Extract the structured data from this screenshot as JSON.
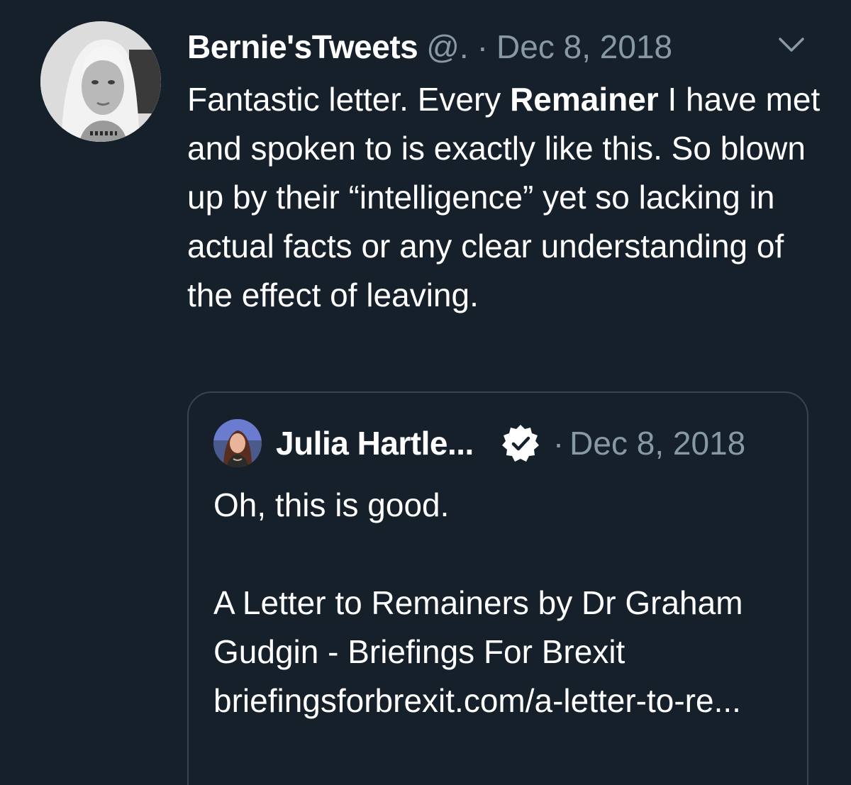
{
  "tweet": {
    "author_name": "Bernie'sTweets",
    "author_handle": "@.",
    "separator": "·",
    "date": "Dec 8, 2018",
    "text_before_bold": "Fantastic letter. Every ",
    "text_bold": "Remainer",
    "text_after_bold": " I have met and spoken to is exactly like this. So blown up by their “intelligence” yet so lacking in actual facts or any clear understanding of the effect of leaving.",
    "menu_icon": "chevron-down-icon"
  },
  "quote": {
    "author_name": "Julia Hartle...",
    "verified_icon": "verified-badge-icon",
    "separator": "·",
    "date": "Dec 8, 2018",
    "line_1": "Oh, this is good.",
    "line_2": "A Letter to Remainers by Dr Graham Gudgin - Briefings For Brexit briefingsforbrexit.com/a-letter-to-re..."
  },
  "colors": {
    "background": "#15202b",
    "text_primary": "#ffffff",
    "text_secondary": "#8899a6",
    "card_border": "#38444d"
  }
}
